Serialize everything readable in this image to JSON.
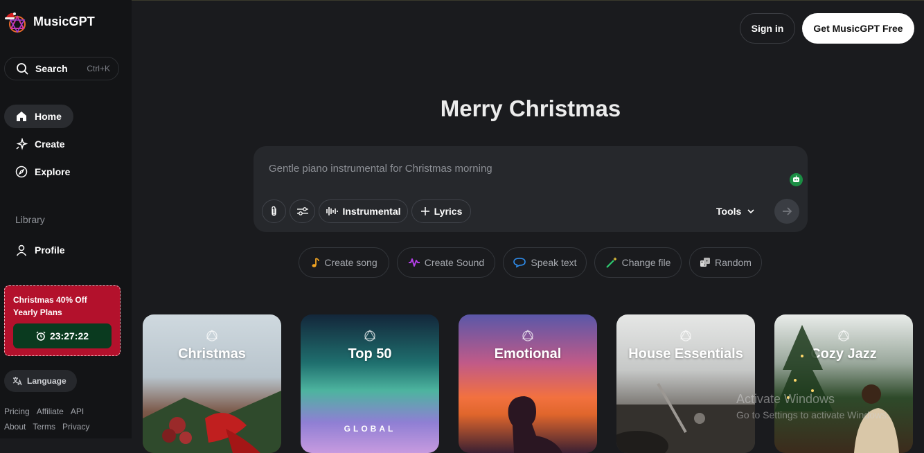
{
  "brand": {
    "name": "MusicGPT"
  },
  "search": {
    "label": "Search",
    "shortcut": "Ctrl+K"
  },
  "nav": {
    "home": "Home",
    "create": "Create",
    "explore": "Explore",
    "library_label": "Library",
    "profile": "Profile"
  },
  "promo": {
    "text": "Christmas 40% Off Yearly Plans",
    "timer": "23:27:22"
  },
  "language": {
    "label": "Language"
  },
  "footer": {
    "pricing": "Pricing",
    "affiliate": "Affiliate",
    "api": "API",
    "about": "About",
    "terms": "Terms",
    "privacy": "Privacy"
  },
  "header": {
    "sign_in": "Sign in",
    "get_free": "Get MusicGPT Free"
  },
  "hero": {
    "title": "Merry Christmas"
  },
  "prompt": {
    "placeholder": "Gentle piano instrumental for Christmas morning",
    "instrumental": "Instrumental",
    "lyrics": "Lyrics",
    "tools": "Tools"
  },
  "chips": [
    "Create song",
    "Create Sound",
    "Speak text",
    "Change file",
    "Random"
  ],
  "cards": [
    {
      "title": "Christmas"
    },
    {
      "title": "Top 50",
      "subtitle": "GLOBAL"
    },
    {
      "title": "Emotional"
    },
    {
      "title": "House Essentials"
    },
    {
      "title": "Cozy Jazz"
    }
  ],
  "watermark": {
    "line1": "Activate Windows",
    "line2": "Go to Settings to activate Windows."
  },
  "colors": {
    "promo": "#b3112c",
    "timer_bg": "#0a3a1f",
    "accent_white": "#ffffff"
  }
}
